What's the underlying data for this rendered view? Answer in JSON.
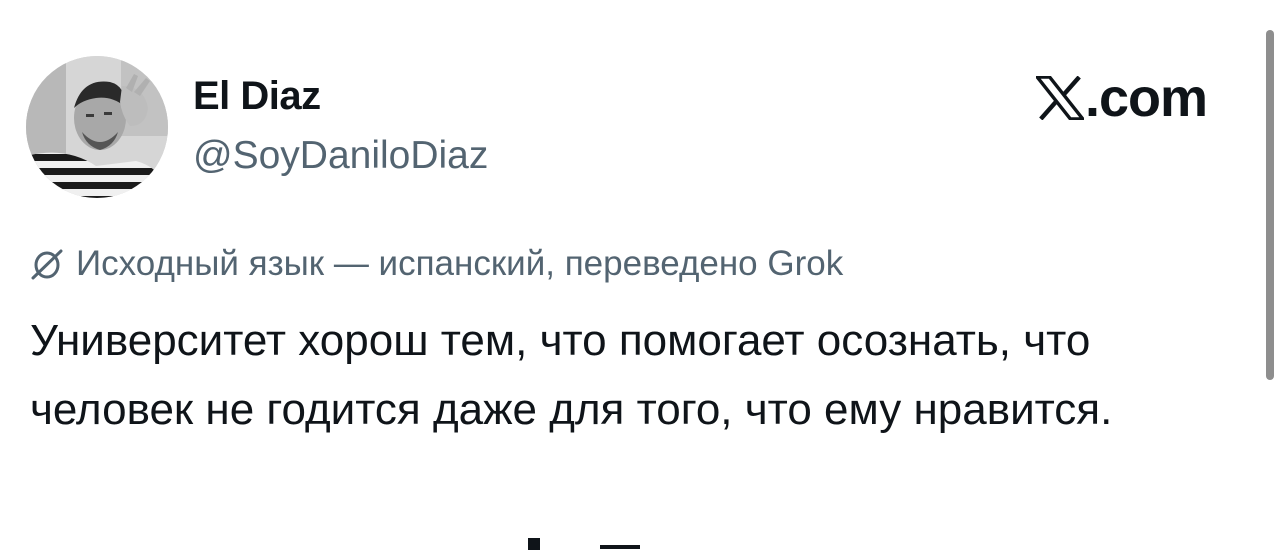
{
  "author": {
    "name": "El Diaz",
    "handle": "@SoyDaniloDiaz"
  },
  "brand": {
    "logo_icon": "x-logo-icon",
    "domain": ".com"
  },
  "translation": {
    "icon": "translate-icon",
    "note": "Исходный язык — испанский, переведено Grok"
  },
  "tweet": {
    "text": "Университет хорош тем, что помогает осознать, что человек не годится даже для того, что ему нравится."
  },
  "colors": {
    "text_primary": "#0f1419",
    "text_secondary": "#536471",
    "background": "#ffffff"
  }
}
